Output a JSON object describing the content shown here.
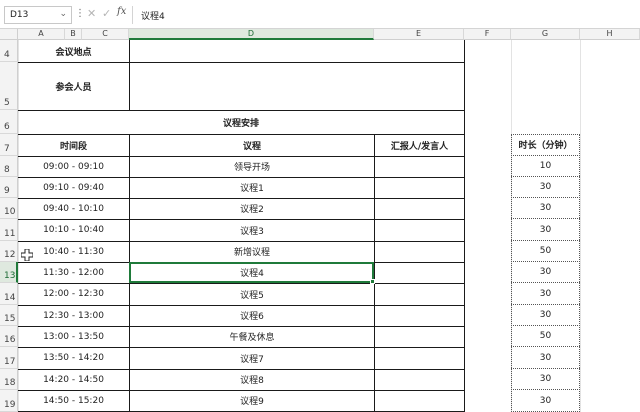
{
  "formula_bar": {
    "name_box": "D13",
    "content": "议程4",
    "fx_label": "fx",
    "cancel_icon": "close-icon",
    "enter_icon": "check-icon"
  },
  "columns": [
    "A",
    "B",
    "C",
    "D",
    "E",
    "F",
    "G",
    "H"
  ],
  "selected_cell": "D13",
  "rows": [
    {
      "num": "4",
      "label": "会议地点",
      "value": ""
    },
    {
      "num": "5",
      "label": "参会人员",
      "value": ""
    },
    {
      "num": "6",
      "section": "议程安排"
    },
    {
      "num": "7",
      "header": {
        "time": "时间段",
        "agenda": "议程",
        "reporter": "汇报人/发言人",
        "duration": "时长（分钟）"
      }
    }
  ],
  "schedule": [
    {
      "row": "8",
      "time": "09:00 - 09:10",
      "item": "领导开场",
      "duration": "10"
    },
    {
      "row": "9",
      "time": "09:10 - 09:40",
      "item": "议程1",
      "duration": "30"
    },
    {
      "row": "10",
      "time": "09:40 - 10:10",
      "item": "议程2",
      "duration": "30"
    },
    {
      "row": "11",
      "time": "10:10 - 10:40",
      "item": "议程3",
      "duration": "30"
    },
    {
      "row": "12",
      "time": "10:40 - 11:30",
      "item": "新增议程",
      "duration": "50"
    },
    {
      "row": "13",
      "time": "11:30 - 12:00",
      "item": "议程4",
      "duration": "30"
    },
    {
      "row": "14",
      "time": "12:00 - 12:30",
      "item": "议程5",
      "duration": "30"
    },
    {
      "row": "15",
      "time": "12:30 - 13:00",
      "item": "议程6",
      "duration": "30"
    },
    {
      "row": "16",
      "time": "13:00 - 13:50",
      "item": "午餐及休息",
      "duration": "50"
    },
    {
      "row": "17",
      "time": "13:50 - 14:20",
      "item": "议程7",
      "duration": "30"
    },
    {
      "row": "18",
      "time": "14:20 - 14:50",
      "item": "议程8",
      "duration": "30"
    },
    {
      "row": "19",
      "time": "14:50 - 15:20",
      "item": "议程9",
      "duration": "30"
    }
  ],
  "accent_color": "#1f7a3a"
}
